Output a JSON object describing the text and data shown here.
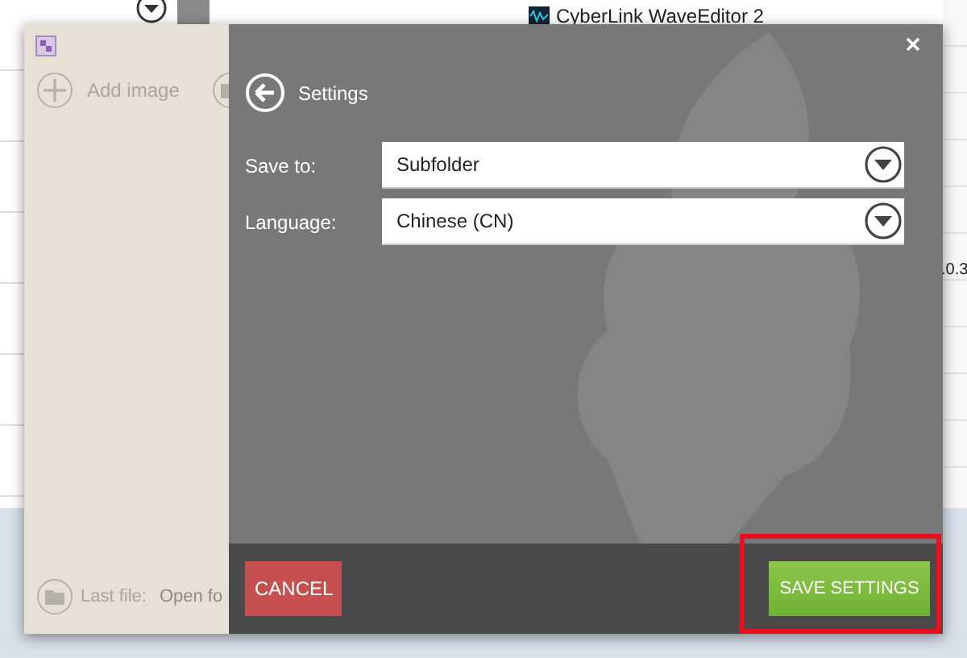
{
  "background_app": {
    "list_item": "CyberLink WaveEditor 2",
    "column_value": ".0.3"
  },
  "left_pane": {
    "add_image": "Add image",
    "last_file_label": "Last file:",
    "last_file_value": "Open fo"
  },
  "dialog": {
    "title": "Settings",
    "fields": [
      {
        "label": "Save to:",
        "value": "Subfolder"
      },
      {
        "label": "Language:",
        "value": "Chinese (CN)"
      }
    ],
    "buttons": [
      {
        "label": "CANCEL",
        "kind": "cancel",
        "highlighted": false
      },
      {
        "label": "SAVE SETTINGS",
        "kind": "save",
        "highlighted": true
      }
    ]
  }
}
